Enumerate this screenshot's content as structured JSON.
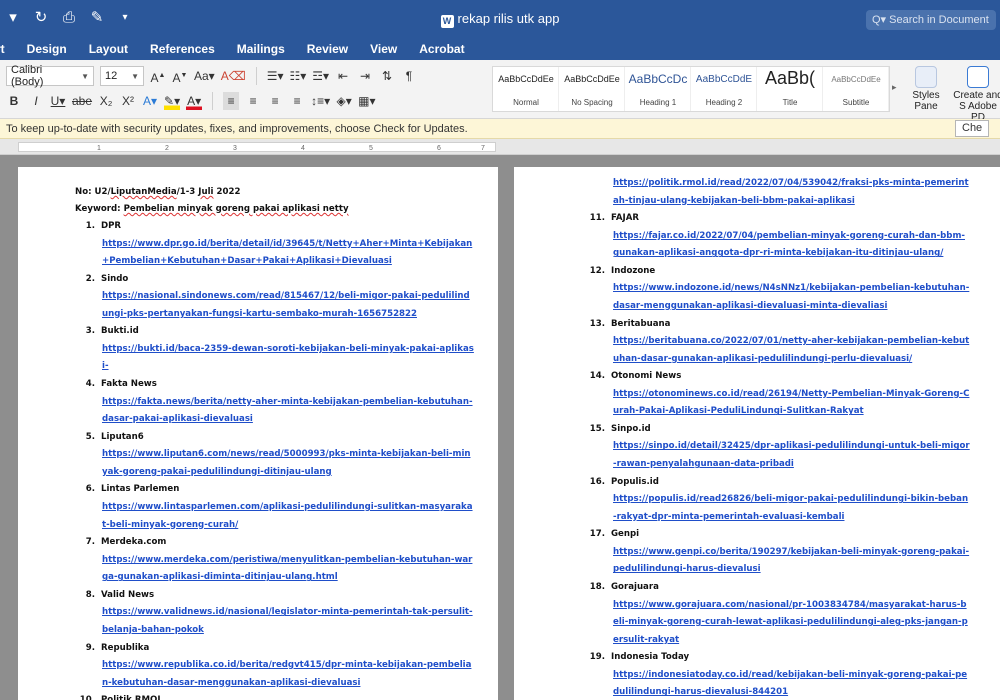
{
  "titlebar": {
    "title": "rekap rilis utk app",
    "search_placeholder": "Search in Document",
    "qat": [
      "redo-icon",
      "print-icon",
      "edit-icon",
      "customize-icon"
    ]
  },
  "tabs": [
    "rt",
    "Design",
    "Layout",
    "References",
    "Mailings",
    "Review",
    "View",
    "Acrobat"
  ],
  "ribbon": {
    "font_name": "Calibri (Body)",
    "font_size": "12",
    "styles": [
      {
        "sample": "AaBbCcDdEe",
        "name": "Normal"
      },
      {
        "sample": "AaBbCcDdEe",
        "name": "No Spacing"
      },
      {
        "sample": "AaBbCcDc",
        "name": "Heading 1"
      },
      {
        "sample": "AaBbCcDdE",
        "name": "Heading 2"
      },
      {
        "sample": "AaBb(",
        "name": "Title"
      },
      {
        "sample": "AaBbCcDdEe",
        "name": "Subtitle"
      }
    ],
    "styles_pane_label": "Styles Pane",
    "create_pdf_label": "Create and S Adobe PD"
  },
  "notice": {
    "message": "To keep up-to-date with security updates, fixes, and improvements, choose Check for Updates.",
    "button": "Che"
  },
  "ruler": {
    "ticks": [
      "1",
      "2",
      "3",
      "4",
      "5",
      "6",
      "7"
    ]
  },
  "document": {
    "page1": {
      "header_no_prefix": "No: U2/",
      "header_no_sq": "LiputanMedia",
      "header_no_mid": "/1-3 ",
      "header_no_sq2": "Juli",
      "header_no_end": " 2022",
      "keyword_prefix": "Keyword: ",
      "keyword_text": "Pembelian minyak goreng pakai aplikasi netty",
      "items": [
        {
          "num": "1.",
          "name": "DPR",
          "link": "https://www.dpr.go.id/berita/detail/id/39645/t/Netty+Aher+Minta+Kebijakan+Pembelian+Kebutuhan+Dasar+Pakai+Aplikasi+Dievaluasi"
        },
        {
          "num": "2.",
          "name": "Sindo",
          "link": "https://nasional.sindonews.com/read/815467/12/beli-migor-pakai-pedulilindungi-pks-pertanyakan-fungsi-kartu-sembako-murah-1656752822"
        },
        {
          "num": "3.",
          "name": "Bukti.id",
          "link": "https://bukti.id/baca-2359-dewan-soroti-kebijakan-beli-minyak-pakai-aplikasi-"
        },
        {
          "num": "4.",
          "name": "Fakta News",
          "link": "https://fakta.news/berita/netty-aher-minta-kebijakan-pembelian-kebutuhan-dasar-pakai-aplikasi-dievaluasi"
        },
        {
          "num": "5.",
          "name": "Liputan6",
          "link": "https://www.liputan6.com/news/read/5000993/pks-minta-kebijakan-beli-minyak-goreng-pakai-pedulilindungi-ditinjau-ulang"
        },
        {
          "num": "6.",
          "name": "Lintas Parlemen",
          "link": "https://www.lintasparlemen.com/aplikasi-pedulilindungi-sulitkan-masyarakat-beli-minyak-goreng-curah/"
        },
        {
          "num": "7.",
          "name": "Merdeka.com",
          "link": "https://www.merdeka.com/peristiwa/menyulitkan-pembelian-kebutuhan-warga-gunakan-aplikasi-diminta-ditinjau-ulang.html"
        },
        {
          "num": "8.",
          "name": "Valid News",
          "link": "https://www.validnews.id/nasional/legislator-minta-pemerintah-tak-persulit-belanja-bahan-pokok"
        },
        {
          "num": "9.",
          "name": "Republika",
          "link": "https://www.republika.co.id/berita/redgvt415/dpr-minta-kebijakan-pembelian-kebutuhan-dasar-menggunakan-aplikasi-dievaluasi"
        },
        {
          "num": "10.",
          "name": "Politik RMOL",
          "link": ""
        }
      ]
    },
    "page2": {
      "lead_link": "https://politik.rmol.id/read/2022/07/04/539042/fraksi-pks-minta-pemerintah-tinjau-ulang-kebijakan-beli-bbm-pakai-aplikasi",
      "items": [
        {
          "num": "11.",
          "name": "FAJAR",
          "link": "https://fajar.co.id/2022/07/04/pembelian-minyak-goreng-curah-dan-bbm-gunakan-aplikasi-anggota-dpr-ri-minta-kebijakan-itu-ditinjau-ulang/"
        },
        {
          "num": "12.",
          "name": "Indozone",
          "link": "https://www.indozone.id/news/N4sNNz1/kebijakan-pembelian-kebutuhan-dasar-menggunakan-aplikasi-dievaluasi-minta-dievaliasi"
        },
        {
          "num": "13.",
          "name": "Beritabuana",
          "link": "https://beritabuana.co/2022/07/01/netty-aher-kebijakan-pembelian-kebutuhan-dasar-gunakan-aplikasi-pedulilindungi-perlu-dievaluasi/"
        },
        {
          "num": "14.",
          "name": "Otonomi News",
          "link": "https://otonominews.co.id/read/26194/Netty-Pembelian-Minyak-Goreng-Curah-Pakai-Aplikasi-PeduliLindungi-Sulitkan-Rakyat"
        },
        {
          "num": "15.",
          "name": "Sinpo.id",
          "link": "https://sinpo.id/detail/32425/dpr-aplikasi-pedulilindungi-untuk-beli-migor-rawan-penyalahgunaan-data-pribadi"
        },
        {
          "num": "16.",
          "name": "Populis.id",
          "link": "https://populis.id/read26826/beli-migor-pakai-pedulilindungi-bikin-beban-rakyat-dpr-minta-pemerintah-evaluasi-kembali"
        },
        {
          "num": "17.",
          "name": "Genpi",
          "link": "https://www.genpi.co/berita/190297/kebijakan-beli-minyak-goreng-pakai-pedulilindungi-harus-dievalusi"
        },
        {
          "num": "18.",
          "name": "Gorajuara",
          "link": "https://www.gorajuara.com/nasional/pr-1003834784/masyarakat-harus-beli-minyak-goreng-curah-lewat-aplikasi-pedulilindungi-aleg-pks-jangan-persulit-rakyat"
        },
        {
          "num": "19.",
          "name": "Indonesia Today",
          "link": "https://indonesiatoday.co.id/read/kebijakan-beli-minyak-goreng-pakai-pedulilindungi-harus-dievalusi-844201"
        }
      ]
    }
  }
}
